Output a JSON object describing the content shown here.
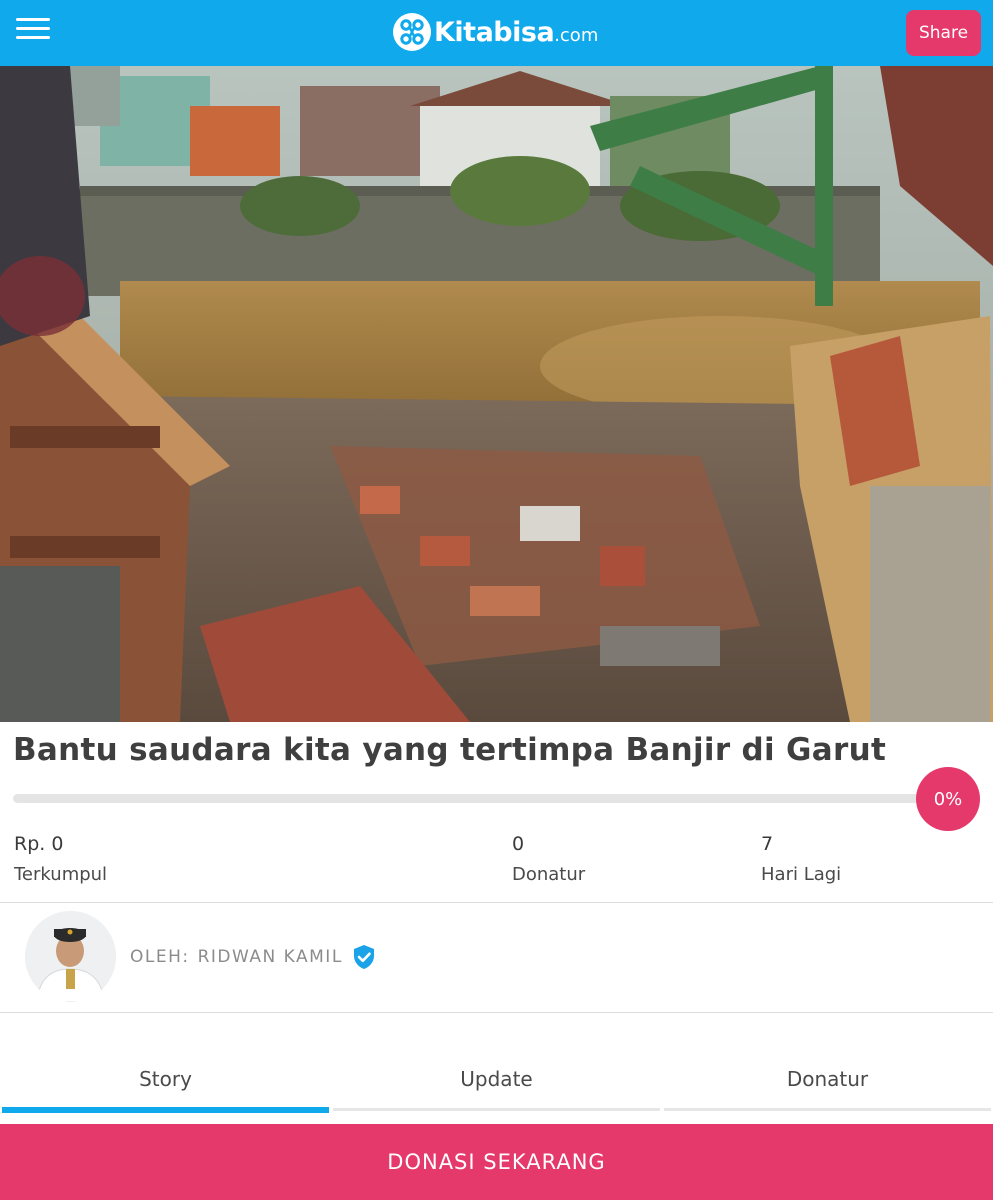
{
  "header": {
    "brand_name": "Kitabisa",
    "brand_tld": ".com",
    "share_label": "Share",
    "menu_icon": "hamburger-menu-icon",
    "bar_color": "#10a9ec"
  },
  "campaign": {
    "title": "Bantu saudara kita yang tertimpa Banjir di Garut",
    "progress_percent": 0,
    "progress_label": "0%",
    "stats": [
      {
        "value": "Rp. 0",
        "label": "Terkumpul"
      },
      {
        "value": "0",
        "label": "Donatur"
      },
      {
        "value": "7",
        "label": "Hari Lagi"
      }
    ]
  },
  "organizer": {
    "prefix": "OLEH:",
    "name": "RIDWAN KAMIL",
    "verified_icon": "verified-badge-icon"
  },
  "tabs": [
    {
      "label": "Story",
      "active": true
    },
    {
      "label": "Update",
      "active": false
    },
    {
      "label": "Donatur",
      "active": false
    }
  ],
  "cta": {
    "donate_label": "DONASI SEKARANG",
    "color": "#e5396c"
  }
}
